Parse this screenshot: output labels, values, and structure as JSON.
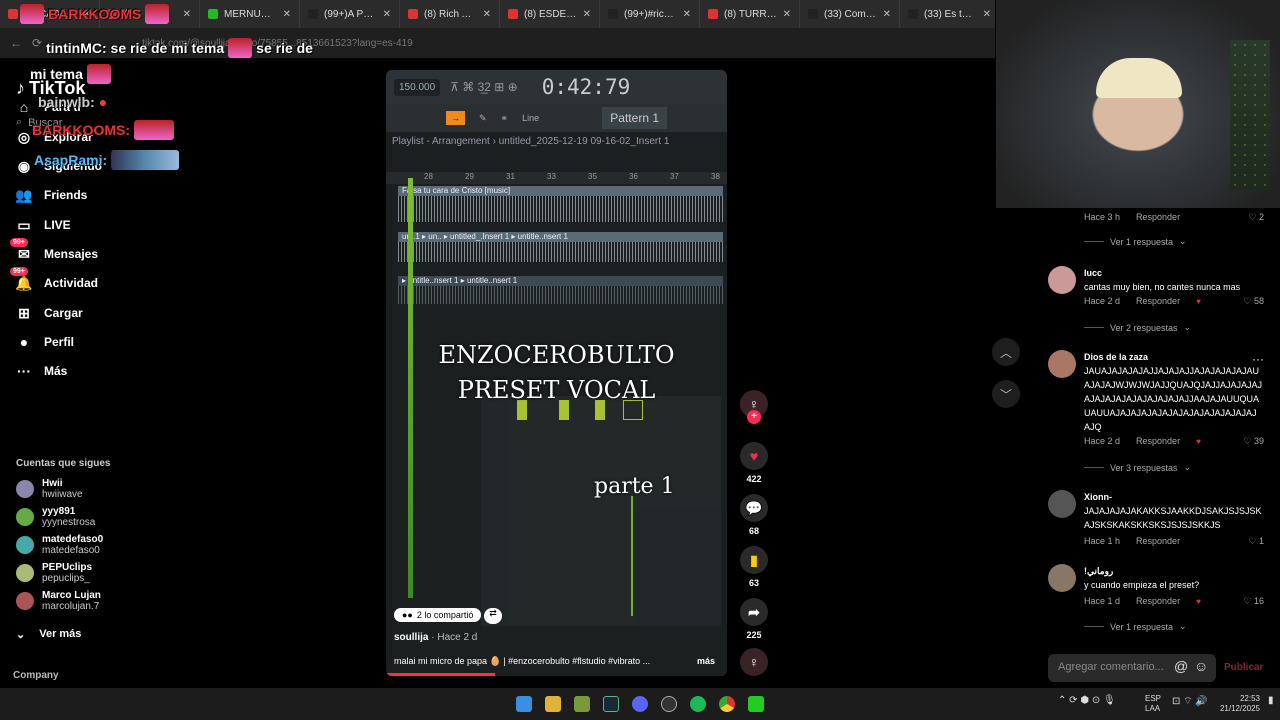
{
  "tabs": [
    {
      "title": "(8) CABING ",
      "color": "#d33"
    },
    {
      "title": "(",
      "color": "#d33"
    },
    {
      "title": "MERNUEL Stre",
      "color": "#2b2"
    },
    {
      "title": "(99+)A Parense",
      "color": "#222"
    },
    {
      "title": "(8) Rich Amiri",
      "color": "#d33"
    },
    {
      "title": "(8) ESDEEKID",
      "color": "#d33"
    },
    {
      "title": "(99+)#richmon",
      "color": "#222"
    },
    {
      "title": "(8) TURROBAB",
      "color": "#d33"
    },
    {
      "title": "(33) Comunida",
      "color": "#222"
    },
    {
      "title": "(33) Es tend",
      "color": "#222"
    }
  ],
  "address": {
    "url": "tiktok.com/@soullija/video/75855...8513661523?lang=es-419"
  },
  "chat": {
    "line1_user": "BARKKOOMS",
    "line2": "tintinMC: se rie de mi tema",
    "line2b": "se rie de",
    "line3": "mi tema",
    "line4_user": "bainwlb:",
    "line5_user": "BARKKOOMS:",
    "line6_user": "AsapRami:"
  },
  "sidebar": {
    "logo": "TikTok",
    "search_placeholder": "Buscar",
    "items": [
      {
        "label": "Para ti",
        "icon": "home-icon",
        "glyph": "⌂"
      },
      {
        "label": "Explorar",
        "icon": "compass-icon",
        "glyph": "◎"
      },
      {
        "label": "Siguiendo",
        "icon": "following-icon",
        "glyph": "◉"
      },
      {
        "label": "Friends",
        "icon": "friends-icon",
        "glyph": "👥"
      },
      {
        "label": "LIVE",
        "icon": "live-icon",
        "glyph": "▭"
      },
      {
        "label": "Mensajes",
        "icon": "messages-icon",
        "glyph": "✉",
        "badge": "99+"
      },
      {
        "label": "Actividad",
        "icon": "activity-icon",
        "glyph": "🔔",
        "badge": "99+"
      },
      {
        "label": "Cargar",
        "icon": "upload-icon",
        "glyph": "⊞"
      },
      {
        "label": "Perfil",
        "icon": "profile-icon",
        "glyph": "●"
      },
      {
        "label": "Más",
        "icon": "more-icon",
        "glyph": "···"
      }
    ],
    "following_title": "Cuentas que sigues",
    "following": [
      {
        "name": "Hwii",
        "handle": "hwiiwave",
        "color": "#88a"
      },
      {
        "name": "yyy891",
        "handle": "yyynestrosa",
        "color": "#6a4"
      },
      {
        "name": "matedefaso0",
        "handle": "matedefaso0",
        "color": "#4aa"
      },
      {
        "name": "PEPUclips",
        "handle": "pepuclips_",
        "color": "#ab7"
      },
      {
        "name": "Marco Lujan",
        "handle": "marcolujan.7",
        "color": "#a55"
      }
    ],
    "see_more": "Ver más",
    "company": "Company"
  },
  "video": {
    "bpm": "150.000",
    "time": "0:42:79",
    "pattern": "Pattern 1",
    "line_mode": "Line",
    "playlist": "Playlist - Arrangement › untitled_2025-12-19 09-16-02_Insert 1",
    "ruler": [
      "28",
      "29",
      "31",
      "33",
      "35",
      "36",
      "37",
      "38"
    ],
    "track1": "Falsa tu cara de Cristo [music]",
    "track2": "un..1  ▸ un..  ▸ untitled_.Insert 1   ▸ untitle..nsert 1",
    "track3": "▸ untitle..nsert 1          ▸ untitle..nsert 1",
    "title_line1": "ENZOCEROBULTO",
    "title_line2": "PRESET VOCAL",
    "parte": "parte 1",
    "shared": "2 lo compartió",
    "author": "soullija",
    "time_ago": "· Hace 2 d",
    "caption": "malai mi micro de papa 🥚 | #enzocerobulto #flstudio #vibrato ...",
    "more": "más",
    "progress": 0.32
  },
  "rail": {
    "likes": "422",
    "comments": "68",
    "saves": "63",
    "shares": "225"
  },
  "comments": [
    {
      "user": "",
      "text": "",
      "time": "Hace 3 h",
      "reply": "Responder",
      "likes": "2",
      "replies": "Ver 1 respuesta"
    },
    {
      "user": "lucc",
      "text": "cantas muy bien, no cantes nunca mas",
      "time": "Hace 2 d",
      "reply": "Responder",
      "likes": "58",
      "replies": "Ver 2 respuestas",
      "color": "#c99"
    },
    {
      "user": "Dios de la zaza",
      "text": "JAUAJAJAJAJAJJAJAJAJJAJAJAJAJAJAUAJAJAJWJWJWJAJJQUAJQJAJJAJAJAJAJAJAJAJAJAJAJAJAJAJAJJAAJAJAUUQUAUAUUAJAJAJAJAJAJAJAJAJAJAJAJAJAJAJQ",
      "time": "Hace 2 d",
      "reply": "Responder",
      "likes": "39",
      "replies": "Ver 3 respuestas",
      "color": "#a76"
    },
    {
      "user": "Xionn-",
      "text": "JAJAJAJAJAKAKKSJAAKKDJSAKJSJSJSKAJSKSKAKSKKSKSJSJSJSKKJS",
      "time": "Hace 1 h",
      "reply": "Responder",
      "likes": "1",
      "color": "#555"
    },
    {
      "user": "!روماني",
      "text": "y cuando empieza el preset?",
      "time": "Hace 1 d",
      "reply": "Responder",
      "likes": "16",
      "replies": "Ver 1 respuesta",
      "color": "#876"
    }
  ],
  "comment_input": {
    "placeholder": "Agregar comentario...",
    "post": "Publicar"
  },
  "taskbar": {
    "lang1": "ESP",
    "lang2": "LAA",
    "time": "22:53",
    "date": "21/12/2025"
  },
  "colors": {
    "accent": "#fe2c55",
    "fl_green": "#7fbf32",
    "fl_orange": "#f08a1c"
  }
}
